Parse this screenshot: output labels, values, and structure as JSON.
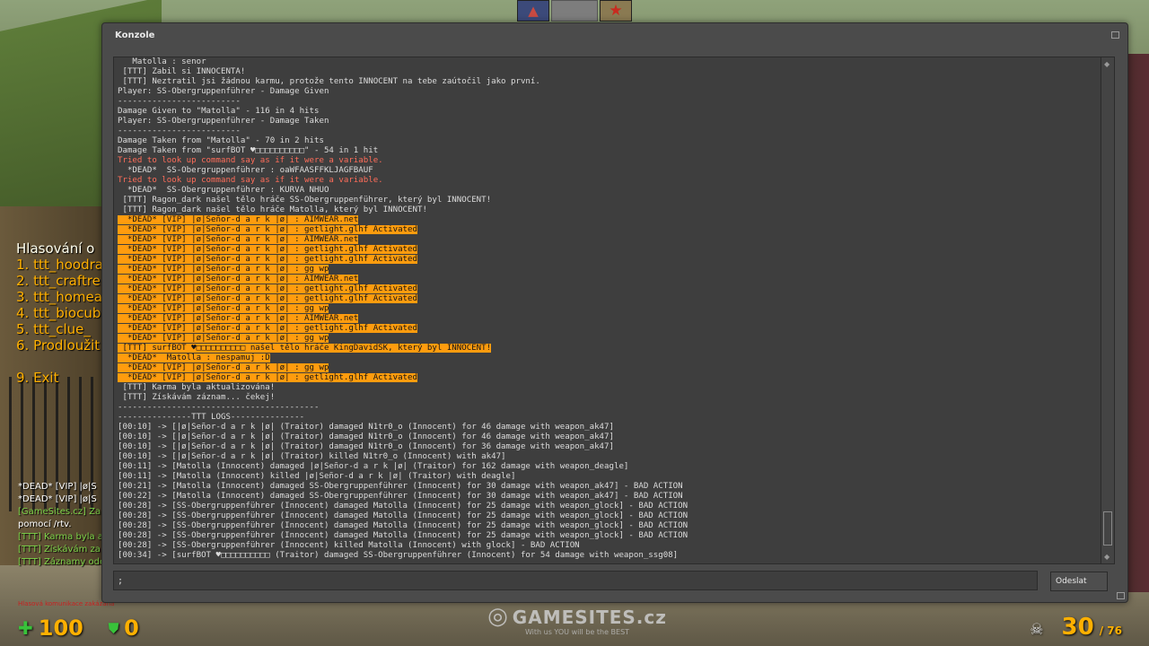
{
  "window": {
    "title": "Konzole",
    "send_label": "Odeslat",
    "command_value": ";"
  },
  "console_lines": [
    {
      "t": "   Matolla : senor",
      "s": "n"
    },
    {
      "t": " [TTT] Zabil si INNOCENTA!",
      "s": "n"
    },
    {
      "t": " [TTT] Neztratil jsi žádnou karmu, protože tento INNOCENT na tebe zaútočil jako první.",
      "s": "n"
    },
    {
      "t": "Player: SS-Obergruppenführer - Damage Given",
      "s": "n"
    },
    {
      "t": "-------------------------",
      "s": "n"
    },
    {
      "t": "Damage Given to \"Matolla\" - 116 in 4 hits",
      "s": "n"
    },
    {
      "t": "Player: SS-Obergruppenführer - Damage Taken",
      "s": "n"
    },
    {
      "t": "-------------------------",
      "s": "n"
    },
    {
      "t": "Damage Taken from \"Matolla\" - 70 in 2 hits",
      "s": "n"
    },
    {
      "t": "Damage Taken from \"surfBOT ♥□□□□□□□□□□\" - 54 in 1 hit",
      "s": "n"
    },
    {
      "t": "Tried to look up command say as if it were a variable.",
      "s": "err"
    },
    {
      "t": "  *DEAD*  SS-Obergruppenführer : oaWFAASFFKLJAGFBAUF",
      "s": "n"
    },
    {
      "t": "Tried to look up command say as if it were a variable.",
      "s": "err"
    },
    {
      "t": "  *DEAD*  SS-Obergruppenführer : KURVA NHUO",
      "s": "n"
    },
    {
      "t": " [TTT] Ragon_dark našel tělo hráče SS-Obergruppenführer, který byl INNOCENT!",
      "s": "n"
    },
    {
      "t": " [TTT] Ragon_dark našel tělo hráče Matolla, který byl INNOCENT!",
      "s": "n"
    },
    {
      "t": "  *DEAD* [VIP] |ø|Señor-d a r k |ø| : AIMWEAR.net",
      "s": "hl"
    },
    {
      "t": "  *DEAD* [VIP] |ø|Señor-d a r k |ø| : getlight.glhf Activated",
      "s": "hl"
    },
    {
      "t": "  *DEAD* [VIP] |ø|Señor-d a r k |ø| : AIMWEAR.net",
      "s": "hl"
    },
    {
      "t": "  *DEAD* [VIP] |ø|Señor-d a r k |ø| : getlight.glhf Activated",
      "s": "hl"
    },
    {
      "t": "  *DEAD* [VIP] |ø|Señor-d a r k |ø| : getlight.glhf Activated",
      "s": "hl"
    },
    {
      "t": "  *DEAD* [VIP] |ø|Señor-d a r k |ø| : gg wp",
      "s": "hl"
    },
    {
      "t": "  *DEAD* [VIP] |ø|Señor-d a r k |ø| : AIMWEAR.net",
      "s": "hl"
    },
    {
      "t": "  *DEAD* [VIP] |ø|Señor-d a r k |ø| : getlight.glhf Activated",
      "s": "hl"
    },
    {
      "t": "  *DEAD* [VIP] |ø|Señor-d a r k |ø| : getlight.glhf Activated",
      "s": "hl"
    },
    {
      "t": "  *DEAD* [VIP] |ø|Señor-d a r k |ø| : gg wp",
      "s": "hl"
    },
    {
      "t": "  *DEAD* [VIP] |ø|Señor-d a r k |ø| : AIMWEAR.net",
      "s": "hl"
    },
    {
      "t": "  *DEAD* [VIP] |ø|Señor-d a r k |ø| : getlight.glhf Activated",
      "s": "hl"
    },
    {
      "t": "  *DEAD* [VIP] |ø|Señor-d a r k |ø| : gg wp",
      "s": "hl"
    },
    {
      "t": " [TTT] surfBOT ♥□□□□□□□□□□ našel tělo hráče KingDavidSK, který byl INNOCENT!",
      "s": "hl"
    },
    {
      "t": "  *DEAD*  Matolla : nespamuj :D",
      "s": "hl"
    },
    {
      "t": "  *DEAD* [VIP] |ø|Señor-d a r k |ø| : gg wp",
      "s": "hl"
    },
    {
      "t": "  *DEAD* [VIP] |ø|Señor-d a r k |ø| : getlight.glhf Activated",
      "s": "hl"
    },
    {
      "t": " [TTT] Karma byla aktualizována!",
      "s": "n"
    },
    {
      "t": " [TTT] Získávám záznam... čekej!",
      "s": "n"
    },
    {
      "t": "-----------------------------------------",
      "s": "n"
    },
    {
      "t": "---------------TTT LOGS---------------",
      "s": "n"
    },
    {
      "t": "[00:10] -> [|ø|Señor-d a r k |ø| (Traitor) damaged N1tr0_o (Innocent) for 46 damage with weapon_ak47]",
      "s": "n"
    },
    {
      "t": "[00:10] -> [|ø|Señor-d a r k |ø| (Traitor) damaged N1tr0_o (Innocent) for 46 damage with weapon_ak47]",
      "s": "n"
    },
    {
      "t": "[00:10] -> [|ø|Señor-d a r k |ø| (Traitor) damaged N1tr0_o (Innocent) for 36 damage with weapon_ak47]",
      "s": "n"
    },
    {
      "t": "[00:10] -> [|ø|Señor-d a r k |ø| (Traitor) killed N1tr0_o (Innocent) with ak47]",
      "s": "n"
    },
    {
      "t": "[00:11] -> [Matolla (Innocent) damaged |ø|Señor-d a r k |ø| (Traitor) for 162 damage with weapon_deagle]",
      "s": "n"
    },
    {
      "t": "[00:11] -> [Matolla (Innocent) killed |ø|Señor-d a r k |ø| (Traitor) with deagle]",
      "s": "n"
    },
    {
      "t": "[00:21] -> [Matolla (Innocent) damaged SS-Obergruppenführer (Innocent) for 30 damage with weapon_ak47] - BAD ACTION",
      "s": "n"
    },
    {
      "t": "[00:22] -> [Matolla (Innocent) damaged SS-Obergruppenführer (Innocent) for 30 damage with weapon_ak47] - BAD ACTION",
      "s": "n"
    },
    {
      "t": "[00:28] -> [SS-Obergruppenführer (Innocent) damaged Matolla (Innocent) for 25 damage with weapon_glock] - BAD ACTION",
      "s": "n"
    },
    {
      "t": "[00:28] -> [SS-Obergruppenführer (Innocent) damaged Matolla (Innocent) for 25 damage with weapon_glock] - BAD ACTION",
      "s": "n"
    },
    {
      "t": "[00:28] -> [SS-Obergruppenführer (Innocent) damaged Matolla (Innocent) for 25 damage with weapon_glock] - BAD ACTION",
      "s": "n"
    },
    {
      "t": "[00:28] -> [SS-Obergruppenführer (Innocent) damaged Matolla (Innocent) for 25 damage with weapon_glock] - BAD ACTION",
      "s": "n"
    },
    {
      "t": "[00:28] -> [SS-Obergruppenführer (Innocent) killed Matolla (Innocent) with glock] - BAD ACTION",
      "s": "n"
    },
    {
      "t": "[00:34] -> [surfBOT ♥□□□□□□□□□□ (Traitor) damaged SS-Obergruppenführer (Innocent) for 54 damage with weapon_ssg08]",
      "s": "n"
    }
  ],
  "vote_menu": {
    "title": "Hlasování o",
    "options": [
      "1. ttt_hoodra",
      "2. ttt_craftre",
      "3. ttt_homea",
      "4. ttt_biocub",
      "5. ttt_clue_",
      "6. Prodloužit"
    ],
    "exit": "9. Exit"
  },
  "chat": [
    {
      "t": "*DEAD* [VIP] |ø|S",
      "g": false
    },
    {
      "t": "*DEAD* [VIP] |ø|S",
      "g": false
    },
    {
      "t": "[GameSites.cz] Za",
      "g": true
    },
    {
      "t": "pomocí /rtv.",
      "g": false
    },
    {
      "t": "[TTT] Karma byla a",
      "g": true
    },
    {
      "t": "[TTT] Získávám za",
      "g": true
    },
    {
      "t": "[TTT] Záznamy ode",
      "g": true
    }
  ],
  "hud": {
    "voice_text": "Hlasová komunikace zakázána",
    "health": "100",
    "armor": "0",
    "ammo_clip": "30",
    "ammo_reserve": "/ 76"
  },
  "branding": {
    "logo": "GAMESITES.cz",
    "tagline": "With us YOU will be the BEST"
  },
  "icons": {
    "health": "plus-icon",
    "armor": "shield-icon",
    "ammo": "skull-icon",
    "team_t": "terrorist-icon",
    "team_ct": "star-icon"
  },
  "colors": {
    "highlight": "#ff9c0e",
    "error_text": "#ff6d5a",
    "hud_amber": "#ffb000",
    "hud_green": "#38c23a"
  }
}
